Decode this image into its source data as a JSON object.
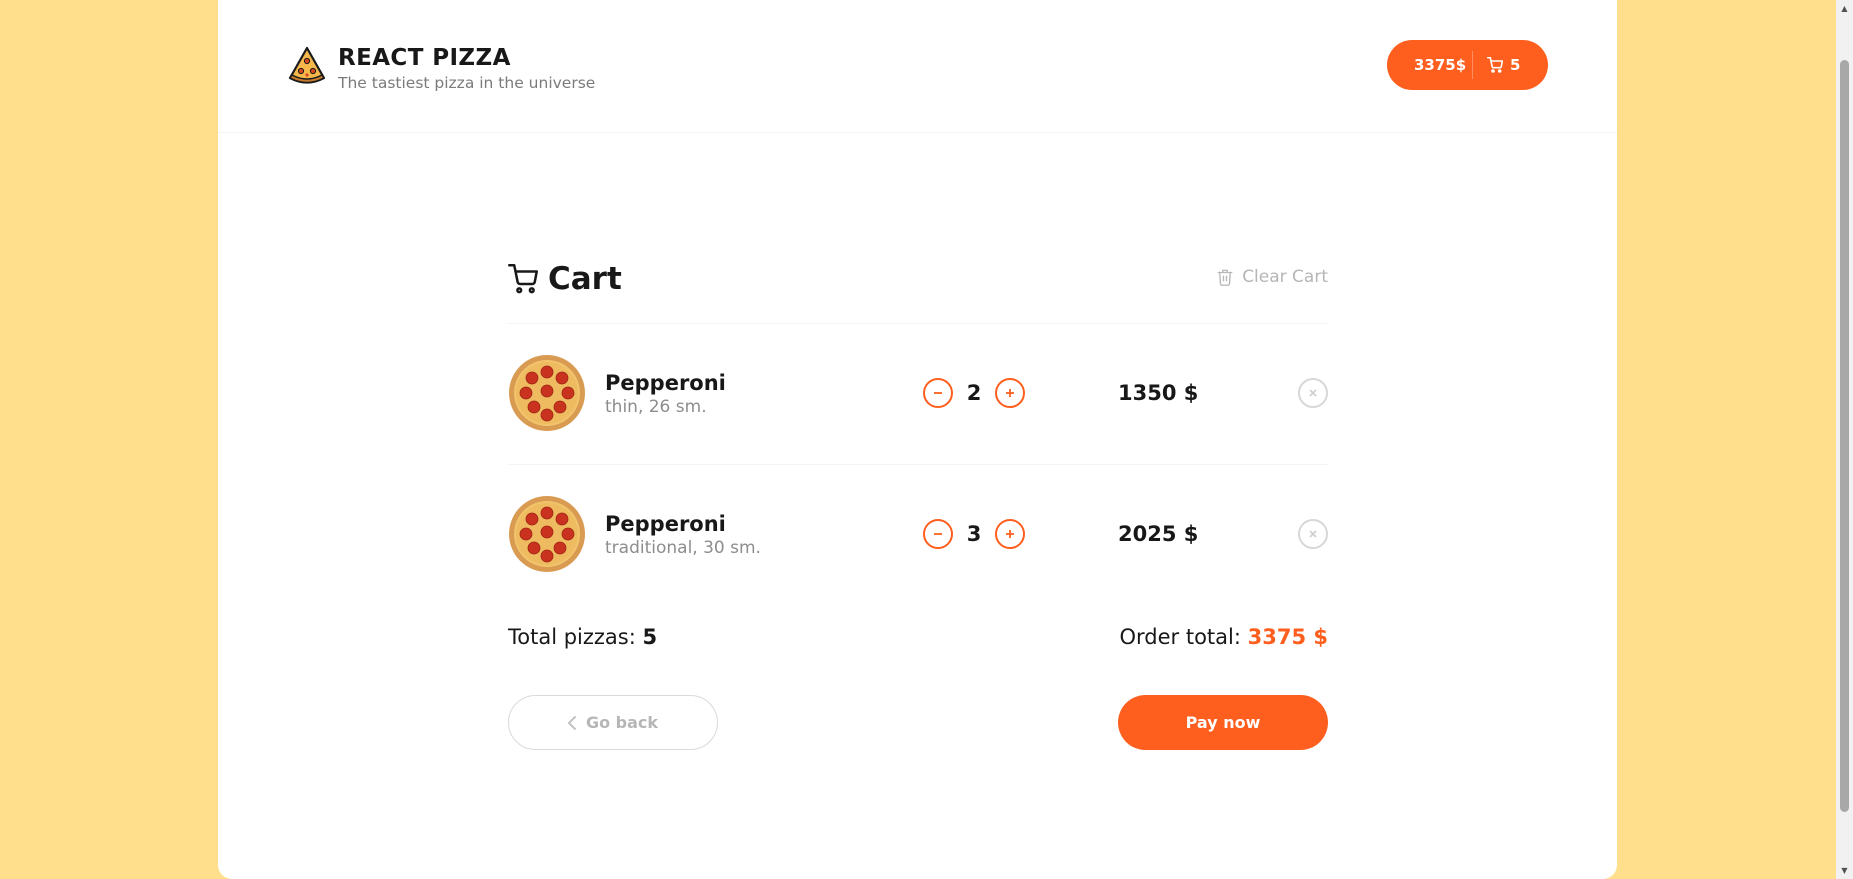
{
  "colors": {
    "accent": "#fe5f1e",
    "background": "#ffdf8c"
  },
  "header": {
    "title": "REACT PIZZA",
    "subtitle": "The tastiest pizza in the universe",
    "cart_button": {
      "price": "3375$",
      "count": "5"
    }
  },
  "cart": {
    "title": "Cart",
    "clear_label": "Clear Cart",
    "items": [
      {
        "name": "Pepperoni",
        "desc": "thin, 26 sm.",
        "count": "2",
        "price": "1350 $"
      },
      {
        "name": "Pepperoni",
        "desc": "traditional, 30 sm.",
        "count": "3",
        "price": "2025 $"
      }
    ],
    "total_pizzas_label": "Total pizzas:",
    "total_pizzas_value": "5",
    "order_total_label": "Order total:",
    "order_total_value": "3375 $",
    "go_back_label": "Go back",
    "pay_label": "Pay now"
  },
  "icons": {
    "logo": "pizza-slice-icon",
    "cart": "shopping-cart-icon",
    "trash": "trash-icon",
    "minus": "minus-icon",
    "plus": "plus-icon",
    "remove": "close-icon",
    "back": "chevron-left-icon"
  }
}
